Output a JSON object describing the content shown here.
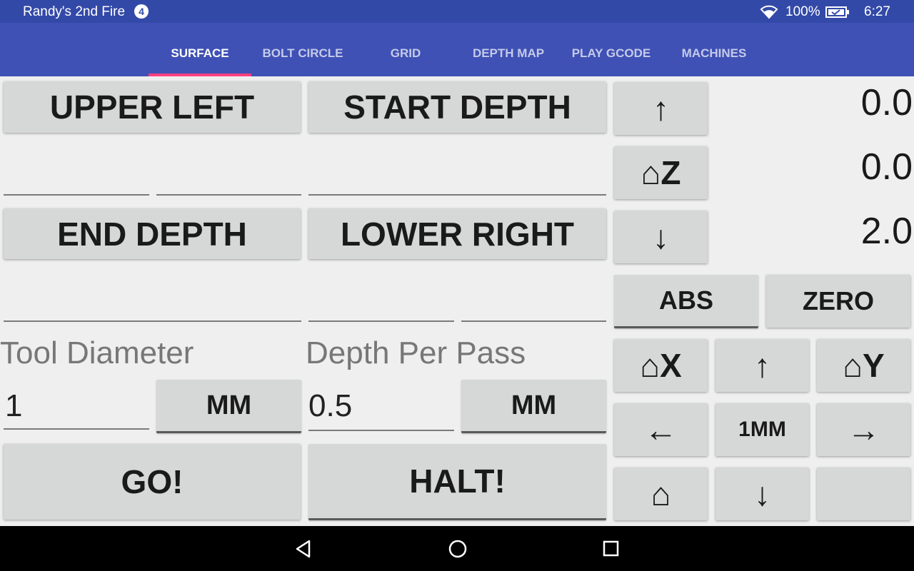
{
  "status": {
    "device_name": "Randy's 2nd Fire",
    "notification_count": "4",
    "battery": "100%",
    "time": "6:27"
  },
  "tabs": [
    {
      "label": "SURFACE",
      "active": true
    },
    {
      "label": "BOLT CIRCLE"
    },
    {
      "label": "GRID"
    },
    {
      "label": "DEPTH MAP"
    },
    {
      "label": "PLAY GCODE"
    },
    {
      "label": "MACHINES"
    }
  ],
  "surface": {
    "upper_left": "UPPER LEFT",
    "start_depth": "START DEPTH",
    "end_depth": "END DEPTH",
    "lower_right": "LOWER RIGHT",
    "upper_left_x": "",
    "upper_left_y": "",
    "start_depth_value": "",
    "end_depth_value": "",
    "lower_right_x": "",
    "lower_right_y": "",
    "tool_diameter_label": "Tool Diameter",
    "tool_diameter_value": "1",
    "tool_diameter_unit": "MM",
    "depth_per_pass_label": "Depth Per Pass",
    "depth_per_pass_value": "0.5",
    "depth_per_pass_unit": "MM",
    "go": "GO!",
    "halt": "HALT!"
  },
  "jog": {
    "z_up": "↑",
    "home_z": "⌂Z",
    "z_down": "↓",
    "x_readout": "0.0",
    "y_readout": "0.0",
    "z_readout": "2.0",
    "abs": "ABS",
    "zero": "ZERO",
    "home_x": "⌂X",
    "y_up": "↑",
    "home_y": "⌂Y",
    "x_left": "←",
    "step": "1MM",
    "x_right": "→",
    "home_all": "⌂",
    "y_down": "↓",
    "blank": ""
  },
  "icons": [
    "wifi-icon",
    "battery-icon",
    "back-icon",
    "home-icon",
    "recents-icon"
  ],
  "colors": {
    "status_bar": "#3349a8",
    "tab_bar": "#3f51b5",
    "tab_indicator": "#ff4081",
    "button": "#d6d7d7",
    "background": "#efefef"
  }
}
